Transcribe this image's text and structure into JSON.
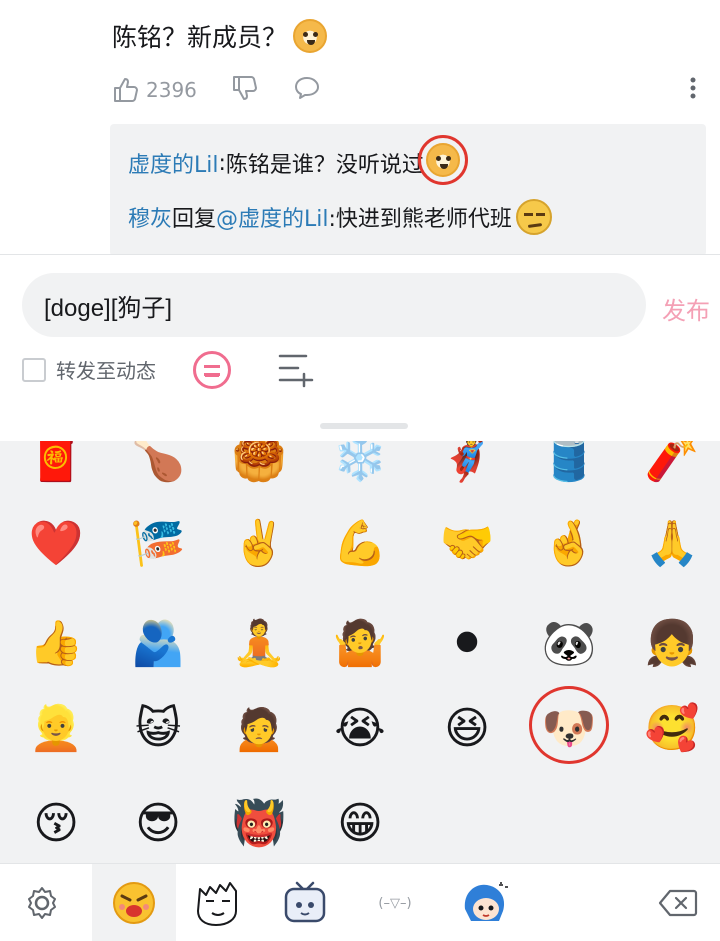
{
  "comment": {
    "text": "陈铭？新成员？",
    "like_count": "2396"
  },
  "sub_replies": [
    {
      "user": "虚度的Lil",
      "sep": ": ",
      "text": "陈铭是谁？没听说过"
    },
    {
      "user": "穆灰",
      "mid": " 回复 ",
      "mention": "@虚度的Lil",
      "text": " :快进到熊老师代班"
    }
  ],
  "composer": {
    "input_value": "[doge][狗子]",
    "publish_label": "发布",
    "forward_label": "转发至动态"
  },
  "emoji_grid": [
    {
      "name": "fortune-emoji",
      "glyph": "🧧"
    },
    {
      "name": "chicken-leg-emoji",
      "glyph": "🍗"
    },
    {
      "name": "mooncake-emoji",
      "glyph": "🥮"
    },
    {
      "name": "snowflake-emoji",
      "glyph": "❄️"
    },
    {
      "name": "character-emoji",
      "glyph": "🦸"
    },
    {
      "name": "barrel-emoji",
      "glyph": "🛢️"
    },
    {
      "name": "cards-emoji",
      "glyph": "🧨"
    },
    {
      "name": "heart-emoji",
      "glyph": "❤️"
    },
    {
      "name": "koi-emoji",
      "glyph": "🎏"
    },
    {
      "name": "victory-hand-emoji",
      "glyph": "✌️"
    },
    {
      "name": "muscle-emoji",
      "glyph": "💪"
    },
    {
      "name": "hands-touch-emoji",
      "glyph": "🤝"
    },
    {
      "name": "crossed-fingers-emoji",
      "glyph": "🤞"
    },
    {
      "name": "pray-emoji",
      "glyph": "🙏"
    },
    {
      "name": "thumbs-up-emoji",
      "glyph": "👍"
    },
    {
      "name": "hug-emoji",
      "glyph": "🫂"
    },
    {
      "name": "meditate-emoji",
      "glyph": "🧘"
    },
    {
      "name": "shrug-emoji",
      "glyph": "🤷"
    },
    {
      "name": "black-hole-emoji",
      "glyph": "⚫"
    },
    {
      "name": "panda-emoji",
      "glyph": "🐼"
    },
    {
      "name": "girl-emoji",
      "glyph": "👧"
    },
    {
      "name": "white-hair-girl-emoji",
      "glyph": "👱"
    },
    {
      "name": "cat-ear-girl-emoji",
      "glyph": "😺"
    },
    {
      "name": "black-hair-girl-emoji",
      "glyph": "🙍"
    },
    {
      "name": "shiba-cry-emoji",
      "glyph": "😭"
    },
    {
      "name": "shiba-laugh-emoji",
      "glyph": "😆"
    },
    {
      "name": "shiba-doge-emoji",
      "glyph": "🐶"
    },
    {
      "name": "shiba-shy-emoji",
      "glyph": "🥰"
    },
    {
      "name": "shiba-kiss-emoji",
      "glyph": "😚"
    },
    {
      "name": "sunglasses-creature-emoji",
      "glyph": "😎"
    },
    {
      "name": "red-creature-emoji",
      "glyph": "👹"
    },
    {
      "name": "grin-creature-emoji",
      "glyph": "😁"
    }
  ],
  "tabs": {
    "kaomoji_label": "(–▽–)"
  },
  "colors": {
    "link_blue": "#2c7bb6",
    "publish_pink": "#f4a0b5",
    "accent_pink": "#f06d8f",
    "highlight_red": "#e0362e"
  }
}
